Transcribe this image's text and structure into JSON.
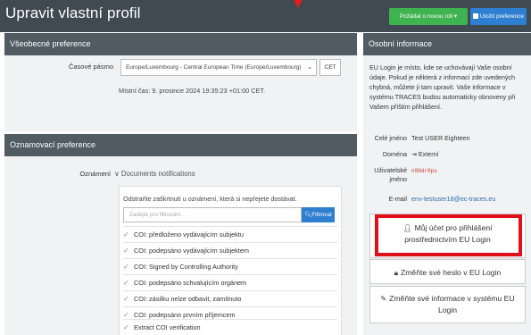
{
  "header": {
    "title": "Upravit vlastní profil",
    "request_role_label": "Požádat o novou roli",
    "save_label": "Uložit preference"
  },
  "general": {
    "title": "Všeobecné preference",
    "timezone_label": "Časové pásmo",
    "timezone_value": "Europe/Luxembourg - Central European Time (Europe/Luxembourg)",
    "timezone_short": "CET",
    "local_time": "Místní čas: 9. prosince 2024 19:35:23 +01:00 CET."
  },
  "notifications": {
    "title": "Oznamovací preference",
    "label": "Oznámení",
    "group": "Documents notifications",
    "hint": "Odstraňte zaškrtnutí u oznámení, která si nepřejete dostávat.",
    "filter_placeholder": "Zadejte pro filtrování...",
    "filter_button": "Filtrovat",
    "items": [
      "COI: předloženo vydávajícím subjektu",
      "COI: podepsáno vydávajícím subjektem",
      "COI: Signed by Controlling Authority",
      "COI: podepsáno schvalujícím orgánem",
      "COI: zásilku nelze odbavit, zamítnuto",
      "COI: podepsáno prvním příjemcem",
      "Extract COI verification"
    ]
  },
  "personal": {
    "title": "Osobní informace",
    "intro": "EU Login je místo, kde se uchovávají Vaše osobní údaje. Pokud je některá z informací zde uvedených chybná, můžete ji tam upravit. Vaše informace v systému TRACES budou automaticky obnoveny při Vašem příštím přihlášení.",
    "full_name_label": "Celé jméno",
    "full_name": "Test USER Eighteen",
    "domain_label": "Doména",
    "domain": "Externí",
    "username_label": "Uživatelské jméno",
    "username": "n00dr0ps",
    "email_label": "E-mail",
    "email": "env-testuser18@ec-traces.eu",
    "btn_account": "Můj účet pro přihlášení prostřednictvím EU Login",
    "btn_password": "Změňte své heslo v EU Login",
    "btn_info": "Změňte své informace v systému EU Login"
  },
  "colors": {
    "header_bg": "#3f4a52",
    "panel_head": "#505b62",
    "green": "#3fb34f",
    "blue": "#2f7fd1",
    "highlight": "#e0101a"
  }
}
